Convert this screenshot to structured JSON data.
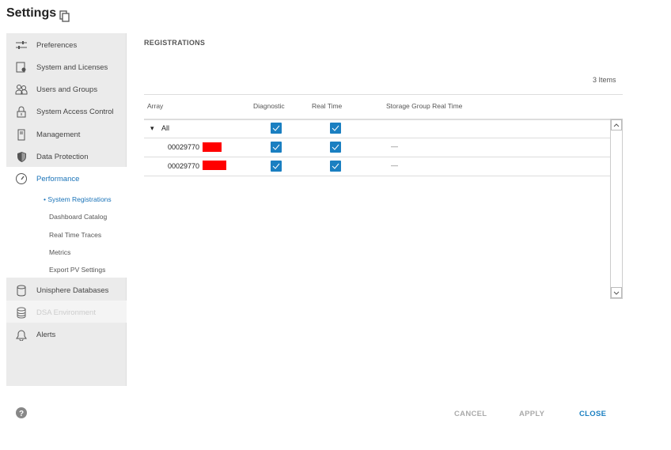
{
  "header": {
    "title": "Settings"
  },
  "sidebar": {
    "items": [
      {
        "label": "Preferences",
        "icon": "sliders-icon"
      },
      {
        "label": "System and Licenses",
        "icon": "license-icon"
      },
      {
        "label": "Users and Groups",
        "icon": "users-icon"
      },
      {
        "label": "System Access Control",
        "icon": "lock-icon"
      },
      {
        "label": "Management",
        "icon": "server-icon"
      },
      {
        "label": "Data Protection",
        "icon": "shield-icon"
      },
      {
        "label": "Performance",
        "icon": "gauge-icon"
      },
      {
        "label": "Unisphere Databases",
        "icon": "database-icon"
      },
      {
        "label": "DSA Environment",
        "icon": "database-stack-icon"
      },
      {
        "label": "Alerts",
        "icon": "bell-icon"
      }
    ],
    "subitems": [
      "System Registrations",
      "Dashboard Catalog",
      "Real Time Traces",
      "Metrics",
      "Export PV Settings"
    ]
  },
  "main": {
    "section": "REGISTRATIONS",
    "count": "3 Items",
    "columns": [
      "Array",
      "Diagnostic",
      "Real Time",
      "Storage Group Real Time"
    ],
    "rows": [
      {
        "array": "All",
        "diagnostic": true,
        "realtime": true,
        "sg": ""
      },
      {
        "array": "00029770",
        "diagnostic": true,
        "realtime": true,
        "sg": "—"
      },
      {
        "array": "00029770",
        "diagnostic": true,
        "realtime": true,
        "sg": "—"
      }
    ]
  },
  "footer": {
    "cancel": "CANCEL",
    "apply": "APPLY",
    "close": "CLOSE"
  },
  "colors": {
    "accent": "#1a7fc1",
    "link": "#1a73b8"
  }
}
